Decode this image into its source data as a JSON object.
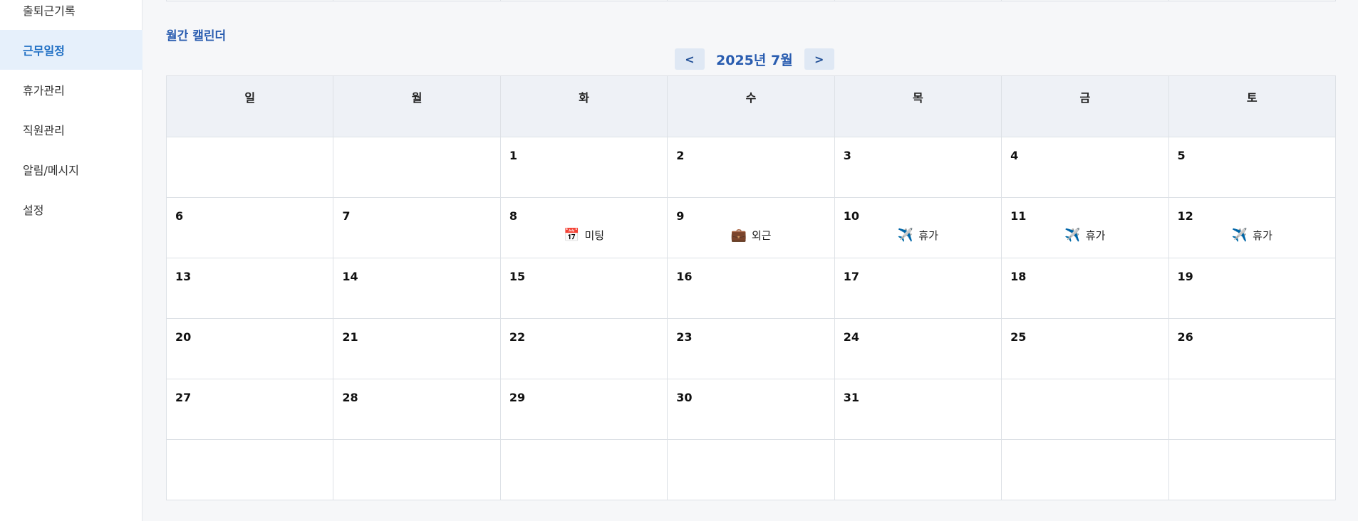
{
  "sidebar": {
    "items": [
      {
        "label": "출퇴근기록",
        "active": false
      },
      {
        "label": "근무일정",
        "active": true
      },
      {
        "label": "휴가관리",
        "active": false
      },
      {
        "label": "직원관리",
        "active": false
      },
      {
        "label": "알림/메시지",
        "active": false
      },
      {
        "label": "설정",
        "active": false
      }
    ]
  },
  "calendar": {
    "section_title": "월간 캘린더",
    "prev_label": "<",
    "next_label": ">",
    "month_label": "2025년 7월",
    "weekdays": [
      "일",
      "월",
      "화",
      "수",
      "목",
      "금",
      "토"
    ],
    "weeks": [
      [
        "",
        "",
        "1",
        "2",
        "3",
        "4",
        "5"
      ],
      [
        "6",
        "7",
        "8",
        "9",
        "10",
        "11",
        "12"
      ],
      [
        "13",
        "14",
        "15",
        "16",
        "17",
        "18",
        "19"
      ],
      [
        "20",
        "21",
        "22",
        "23",
        "24",
        "25",
        "26"
      ],
      [
        "27",
        "28",
        "29",
        "30",
        "31",
        "",
        ""
      ],
      [
        "",
        "",
        "",
        "",
        "",
        "",
        ""
      ]
    ],
    "events": {
      "8": {
        "icon": "calendar-icon",
        "glyph": "📅",
        "label": "미팅"
      },
      "9": {
        "icon": "briefcase-icon",
        "glyph": "💼",
        "label": "외근"
      },
      "10": {
        "icon": "airplane-icon",
        "glyph": "✈️",
        "label": "휴가"
      },
      "11": {
        "icon": "airplane-icon",
        "glyph": "✈️",
        "label": "휴가"
      },
      "12": {
        "icon": "airplane-icon",
        "glyph": "✈️",
        "label": "휴가"
      }
    }
  },
  "colors": {
    "accent": "#2a5db0",
    "active_bg": "#e6f0fb",
    "active_text": "#1f6fc4",
    "header_bg": "#eef1f6"
  }
}
